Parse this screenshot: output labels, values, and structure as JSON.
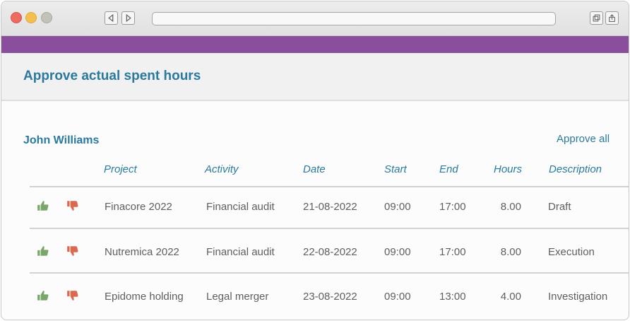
{
  "page": {
    "title": "Approve actual spent hours"
  },
  "employee": {
    "name": "John Williams",
    "approve_all_label": "Approve all"
  },
  "table": {
    "headers": [
      "Project",
      "Activity",
      "Date",
      "Start",
      "End",
      "Hours",
      "Description"
    ],
    "rows": [
      {
        "project": "Finacore 2022",
        "activity": "Financial audit",
        "date": "21-08-2022",
        "start": "09:00",
        "end": "17:00",
        "hours": "8.00",
        "description": "Draft"
      },
      {
        "project": "Nutremica 2022",
        "activity": "Financial audit",
        "date": "22-08-2022",
        "start": "09:00",
        "end": "17:00",
        "hours": "8.00",
        "description": "Execution"
      },
      {
        "project": "Epidome holding",
        "activity": "Legal merger",
        "date": "23-08-2022",
        "start": "09:00",
        "end": "13:00",
        "hours": "4.00",
        "description": "Investigation"
      }
    ]
  },
  "icons": {
    "approve": "thumbs-up-icon",
    "reject": "thumbs-down-icon"
  },
  "colors": {
    "accent": "#2b7a9e",
    "brand_bar": "#8a4f9c",
    "approve": "#7aa66b",
    "reject": "#d9694f"
  }
}
